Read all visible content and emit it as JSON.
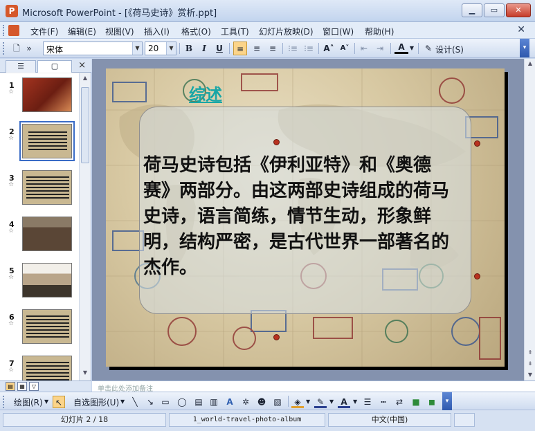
{
  "window": {
    "title": "Microsoft PowerPoint - [《荷马史诗》赏析.ppt]",
    "app_icon": "P",
    "controls": [
      "minimize",
      "maximize",
      "close"
    ]
  },
  "menu": {
    "items": [
      "文件(F)",
      "编辑(E)",
      "视图(V)",
      "插入(I)",
      "格式(O)",
      "工具(T)",
      "幻灯片放映(D)",
      "窗口(W)",
      "帮助(H)"
    ],
    "close_glyph": "✕"
  },
  "format_toolbar": {
    "font_name": "宋体",
    "font_size": "20",
    "bold": "B",
    "italic": "I",
    "underline": "U",
    "design_label": "设计(S)"
  },
  "left_panel": {
    "tab_outline_icon": "outline-icon",
    "tab_slides_icon": "slides-icon",
    "close_glyph": "×",
    "slides": [
      {
        "num": "1",
        "selected": false
      },
      {
        "num": "2",
        "selected": true
      },
      {
        "num": "3",
        "selected": false
      },
      {
        "num": "4",
        "selected": false
      },
      {
        "num": "5",
        "selected": false
      },
      {
        "num": "6",
        "selected": false
      },
      {
        "num": "7",
        "selected": false
      }
    ]
  },
  "slide": {
    "title": "综述",
    "body": "荷马史诗包括《伊利亚特》和《奥德赛》两部分。由这两部史诗组成的荷马史诗，语言简练，情节生动，形象鲜明，结构严密，是古代世界一部著名的杰作。",
    "title_color": "#18a6a6"
  },
  "notes": {
    "hint": "单击此处添加备注"
  },
  "draw_toolbar": {
    "draw_label": "绘图(R)",
    "autoshape_label": "自选图形(U)"
  },
  "status": {
    "slide_position": "幻灯片 2 / 18",
    "template": "1_world-travel-photo-album",
    "language": "中文(中国)"
  }
}
